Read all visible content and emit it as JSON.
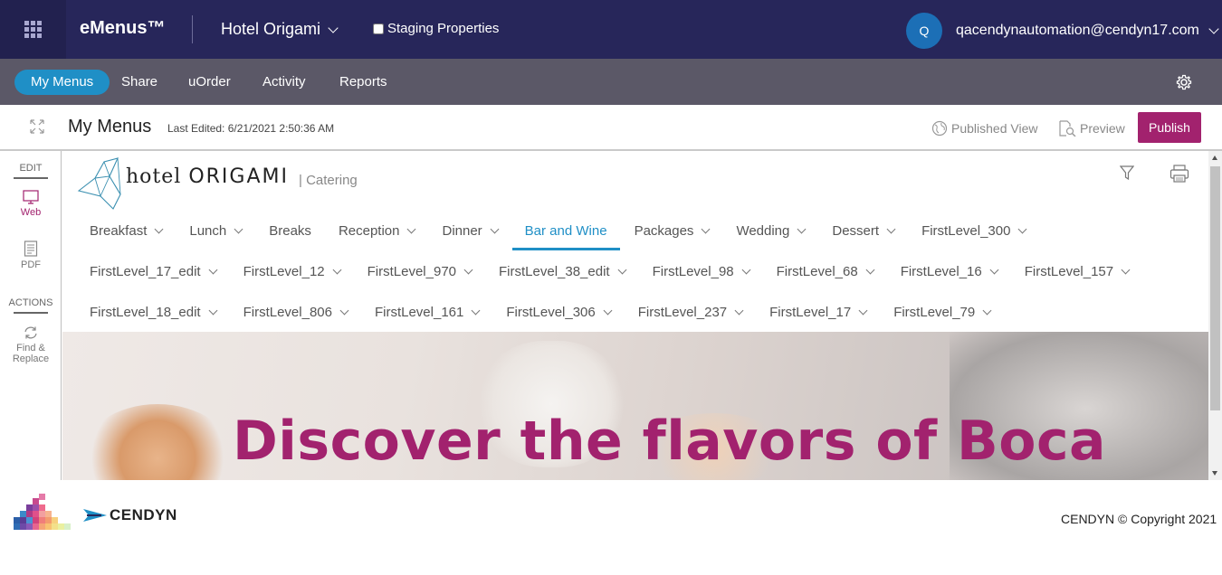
{
  "topbar": {
    "brand": "eMenus™",
    "property": "Hotel Origami",
    "staging_label": "Staging Properties",
    "avatar_initial": "Q",
    "user_email": "qacendynautomation@cendyn17.com"
  },
  "nav": {
    "items": [
      {
        "label": "My Menus",
        "active": true
      },
      {
        "label": "Share"
      },
      {
        "label": "uOrder"
      },
      {
        "label": "Activity"
      },
      {
        "label": "Reports"
      }
    ]
  },
  "toolbar": {
    "title": "My Menus",
    "last_edited": "Last Edited: 6/21/2021 2:50:36 AM",
    "published_view": "Published View",
    "preview": "Preview",
    "publish": "Publish"
  },
  "rail": {
    "edit_header": "EDIT",
    "web": "Web",
    "pdf": "PDF",
    "actions_header": "ACTIONS",
    "find_replace_1": "Find &",
    "find_replace_2": "Replace"
  },
  "menu": {
    "logo_word1": "hotel",
    "logo_word2": "ORIGAMI",
    "section": "| Catering",
    "row1": [
      "Breakfast",
      "Lunch",
      "Breaks",
      "Reception",
      "Dinner",
      "Bar and Wine",
      "Packages",
      "Wedding",
      "Dessert",
      "FirstLevel_300"
    ],
    "row2": [
      "FirstLevel_17_edit",
      "FirstLevel_12",
      "FirstLevel_970",
      "FirstLevel_38_edit",
      "FirstLevel_98",
      "FirstLevel_68",
      "FirstLevel_16",
      "FirstLevel_157"
    ],
    "row3": [
      "FirstLevel_18_edit",
      "FirstLevel_806",
      "FirstLevel_161",
      "FirstLevel_306",
      "FirstLevel_237",
      "FirstLevel_17",
      "FirstLevel_79"
    ],
    "hero_title": "Discover the flavors of Boca"
  },
  "footer": {
    "brand": "CENDYN",
    "copyright": "CENDYN © Copyright 2021"
  },
  "colors": {
    "topbar": "#27265a",
    "navbar": "#5b5867",
    "accent_blue": "#1f8fc6",
    "accent_magenta": "#a2226e"
  }
}
